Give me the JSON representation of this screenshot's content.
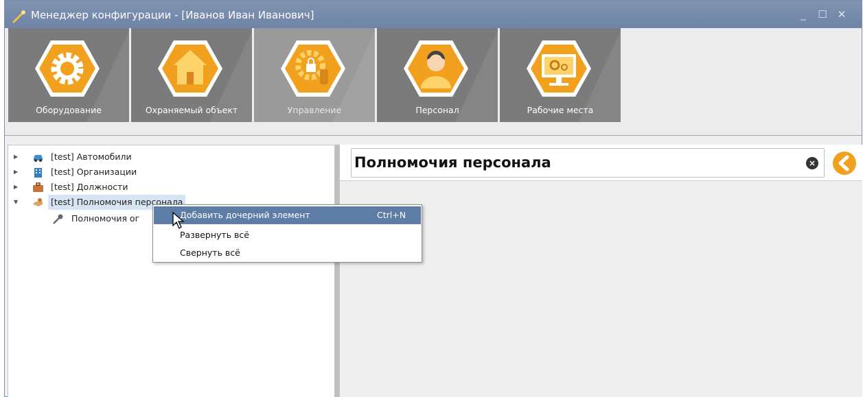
{
  "window": {
    "title": "Менеджер конфигурации - [Иванов Иван Иванович]",
    "controls": {
      "minimize": "_",
      "maximize": "☐",
      "close": "✕"
    }
  },
  "ribbon": {
    "tiles": [
      {
        "label": "Оборудование",
        "icon": "gear-icon",
        "active": false
      },
      {
        "label": "Охраняемый объект",
        "icon": "house-icon",
        "active": false
      },
      {
        "label": "Управление",
        "icon": "gear-lock-hand-icon",
        "active": true
      },
      {
        "label": "Персонал",
        "icon": "person-icon",
        "active": false
      },
      {
        "label": "Рабочие места",
        "icon": "monitor-gears-icon",
        "active": false
      }
    ]
  },
  "tree": {
    "items": [
      {
        "label": "[test] Автомобили",
        "icon": "car-icon",
        "expanded": false
      },
      {
        "label": "[test] Организации",
        "icon": "building-icon",
        "expanded": false
      },
      {
        "label": "[test] Должности",
        "icon": "briefcase-icon",
        "expanded": false
      },
      {
        "label": "[test] Полномочия персонала",
        "icon": "key-hand-icon",
        "expanded": true,
        "selected": true
      }
    ],
    "child": {
      "label": "Полномочия ог",
      "icon": "key-icon"
    }
  },
  "detail": {
    "heading": "Полномочия персонала",
    "clear_icon": "clear-icon",
    "back_icon": "back-arrow-icon"
  },
  "context_menu": {
    "items": [
      {
        "label": "Добавить дочерний элемент",
        "shortcut": "Ctrl+N",
        "highlighted": true
      },
      {
        "label": "Развернуть всё",
        "shortcut": "",
        "highlighted": false
      },
      {
        "label": "Свернуть всё",
        "shortcut": "",
        "highlighted": false
      }
    ]
  },
  "colors": {
    "titlebar": "#7389aa",
    "tile": "#7b7b7b",
    "tile_active": "#9a9a9a",
    "accent_orange": "#f2a11f",
    "menu_highlight": "#5e7da6"
  }
}
